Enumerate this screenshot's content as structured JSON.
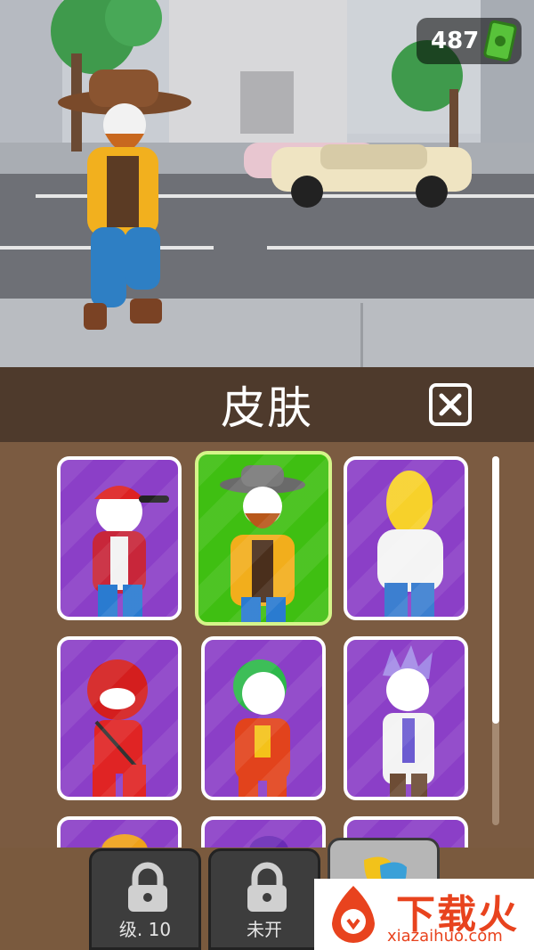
{
  "currency": {
    "amount": "487",
    "icon": "cash-icon"
  },
  "panel": {
    "title": "皮肤",
    "close_icon": "close-icon"
  },
  "skins": [
    {
      "name": "skin-red-cap",
      "selected": false
    },
    {
      "name": "skin-cowboy",
      "selected": true
    },
    {
      "name": "skin-yellow-guy",
      "selected": false
    },
    {
      "name": "skin-red-ninja",
      "selected": false
    },
    {
      "name": "skin-joker",
      "selected": false
    },
    {
      "name": "skin-scientist",
      "selected": false
    }
  ],
  "tabs": [
    {
      "label": "级. 10",
      "locked": true
    },
    {
      "label": "未开",
      "locked": true
    },
    {
      "label": "",
      "locked": false,
      "icon": "masks-icon"
    }
  ],
  "watermark": {
    "text": "下载火",
    "url": "xiazaihuo.com"
  },
  "colors": {
    "card_purple": "#8b3fc7",
    "card_selected": "#3fbf12",
    "panel_brown": "#4e3a2c"
  }
}
